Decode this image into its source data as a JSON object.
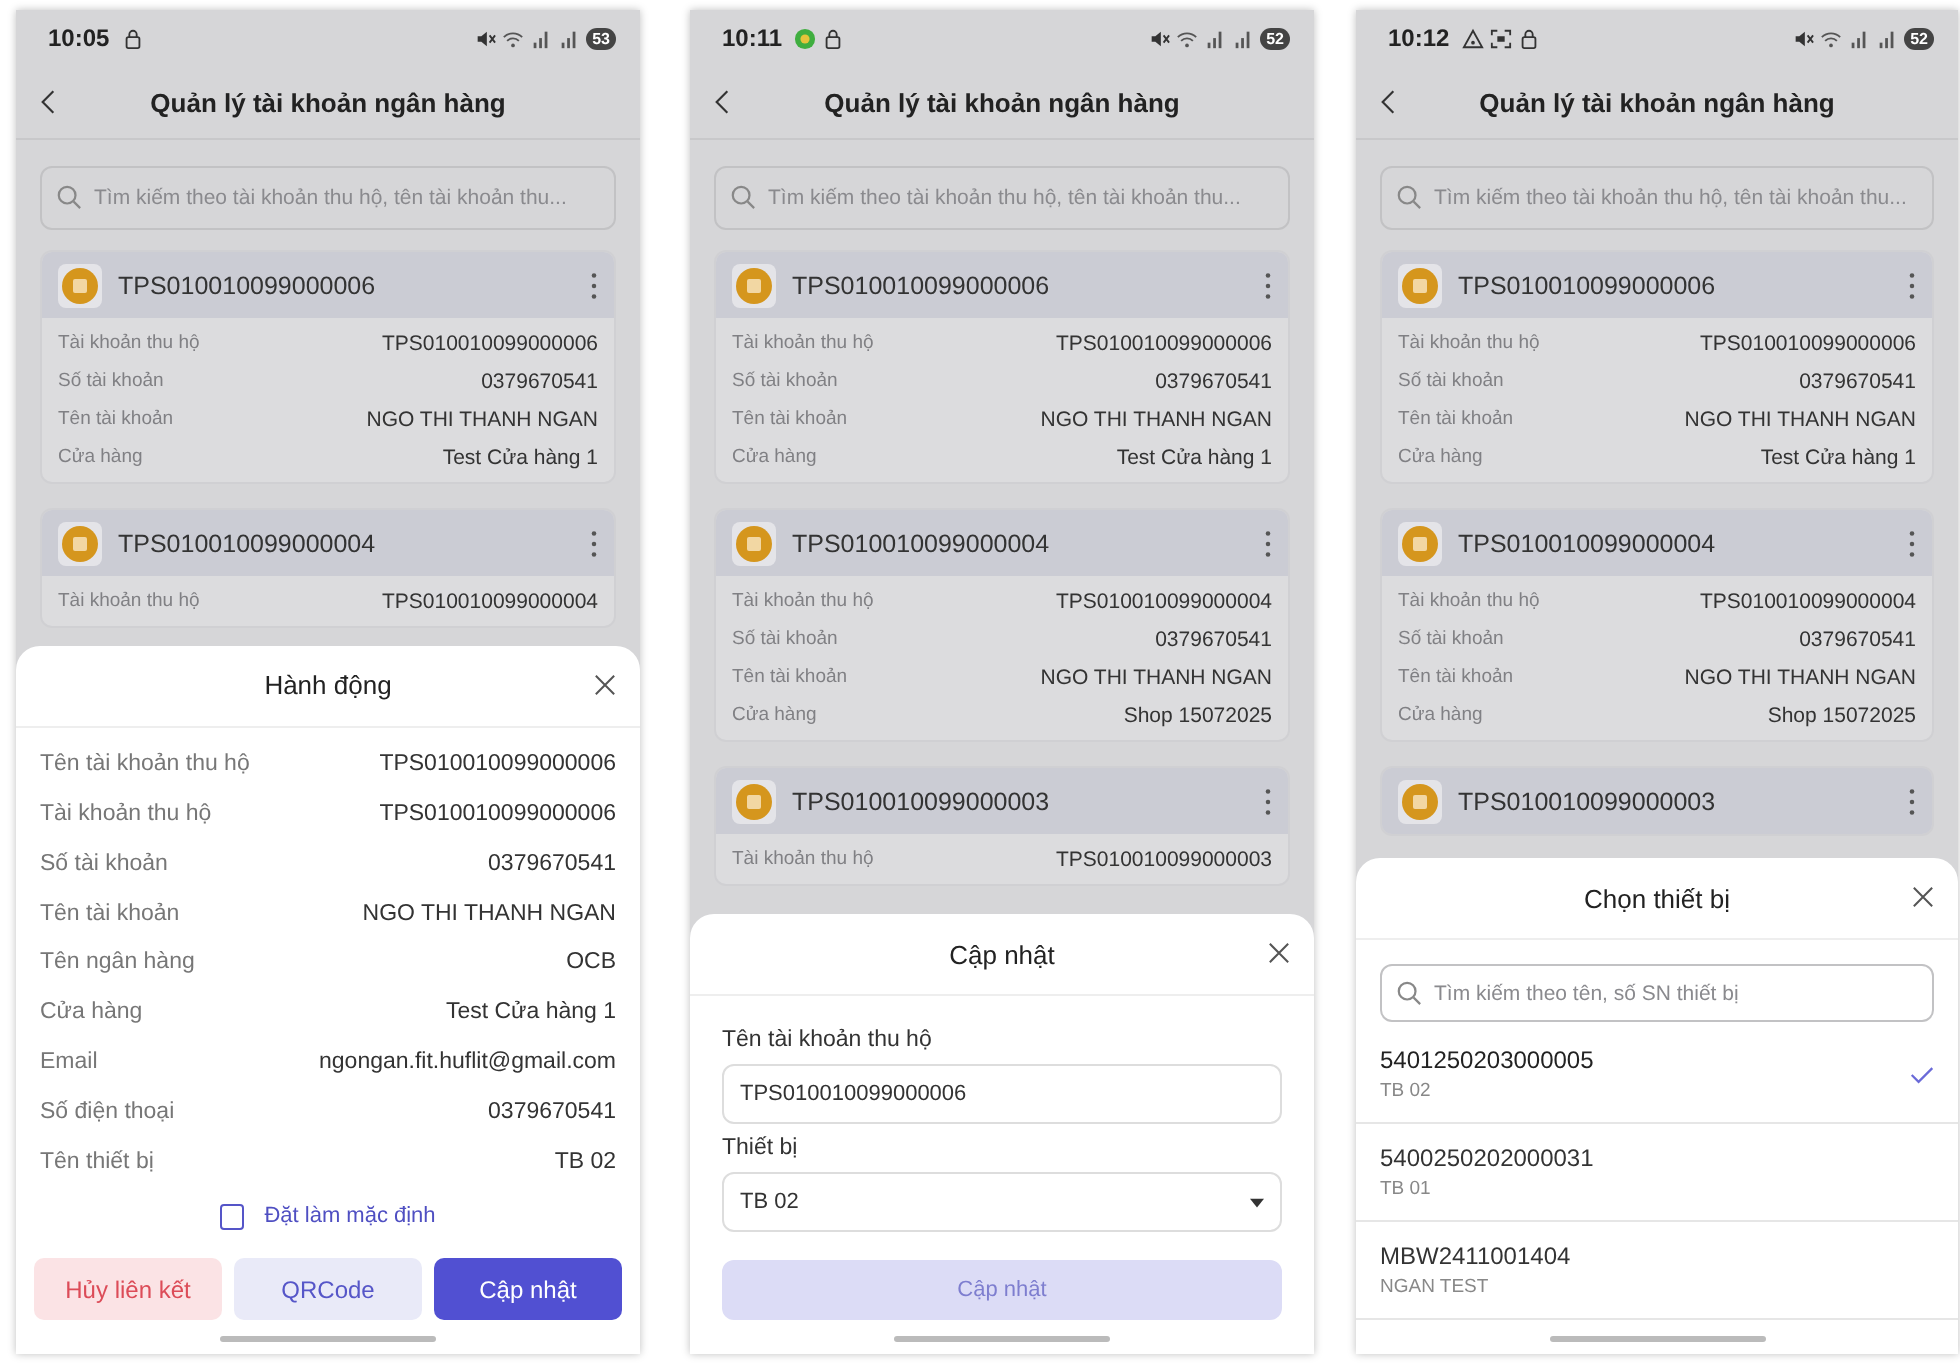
{
  "screens": [
    {
      "status_time": "10:05",
      "battery": "53",
      "title": "Quản lý tài khoản ngân hàng",
      "search_placeholder": "Tìm kiếm theo tài khoản thu hộ, tên tài khoản thu...",
      "accounts": [
        {
          "name": "TPS010010099000006",
          "fields": [
            {
              "label": "Tài khoản thu hộ",
              "value": "TPS010010099000006"
            },
            {
              "label": "Số tài khoản",
              "value": "0379670541"
            },
            {
              "label": "Tên tài khoản",
              "value": "NGO THI THANH NGAN"
            },
            {
              "label": "Cửa hàng",
              "value": "Test Cửa hàng 1"
            }
          ]
        },
        {
          "name": "TPS010010099000004",
          "fields": [
            {
              "label": "Tài khoản thu hộ",
              "value": "TPS010010099000004"
            }
          ]
        }
      ],
      "sheet": {
        "kind": "details",
        "title": "Hành động",
        "rows": [
          {
            "label": "Tên tài khoản thu hộ",
            "value": "TPS010010099000006"
          },
          {
            "label": "Tài khoản thu hộ",
            "value": "TPS010010099000006"
          },
          {
            "label": "Số tài khoản",
            "value": "0379670541"
          },
          {
            "label": "Tên tài khoản",
            "value": "NGO THI THANH NGAN"
          },
          {
            "label": "Tên ngân hàng",
            "value": "OCB"
          },
          {
            "label": "Cửa hàng",
            "value": "Test Cửa hàng 1"
          },
          {
            "label": "Email",
            "value": "ngongan.fit.huflit@gmail.com"
          },
          {
            "label": "Số điện thoại",
            "value": "0379670541"
          },
          {
            "label": "Tên thiết bị",
            "value": "TB 02"
          }
        ],
        "default_option": {
          "label": "Đặt làm mặc định",
          "checked": false
        },
        "buttons": [
          {
            "label": "Hủy liên kết",
            "kind": "danger"
          },
          {
            "label": "QRCode",
            "kind": "secondary"
          },
          {
            "label": "Cập nhật",
            "kind": "primary"
          }
        ]
      }
    },
    {
      "status_time": "10:11",
      "battery": "52",
      "title": "Quản lý tài khoản ngân hàng",
      "search_placeholder": "Tìm kiếm theo tài khoản thu hộ, tên tài khoản thu...",
      "accounts": [
        {
          "name": "TPS010010099000006",
          "fields": [
            {
              "label": "Tài khoản thu hộ",
              "value": "TPS010010099000006"
            },
            {
              "label": "Số tài khoản",
              "value": "0379670541"
            },
            {
              "label": "Tên tài khoản",
              "value": "NGO THI THANH NGAN"
            },
            {
              "label": "Cửa hàng",
              "value": "Test Cửa hàng 1"
            }
          ]
        },
        {
          "name": "TPS010010099000004",
          "fields": [
            {
              "label": "Tài khoản thu hộ",
              "value": "TPS010010099000004"
            },
            {
              "label": "Số tài khoản",
              "value": "0379670541"
            },
            {
              "label": "Tên tài khoản",
              "value": "NGO THI THANH NGAN"
            },
            {
              "label": "Cửa hàng",
              "value": "Shop 15072025"
            }
          ]
        },
        {
          "name": "TPS010010099000003",
          "fields": [
            {
              "label": "Tài khoản thu hộ",
              "value": "TPS010010099000003"
            }
          ]
        }
      ],
      "sheet": {
        "kind": "form",
        "title": "Cập nhật",
        "fields": [
          {
            "label": "Tên tài khoản thu hộ",
            "kind": "text",
            "value": "TPS010010099000006"
          },
          {
            "label": "Thiết bị",
            "kind": "select",
            "value": "TB 02"
          }
        ],
        "submit": {
          "label": "Cập nhật",
          "disabled": true
        }
      }
    },
    {
      "status_time": "10:12",
      "battery": "52",
      "title": "Quản lý tài khoản ngân hàng",
      "search_placeholder": "Tìm kiếm theo tài khoản thu hộ, tên tài khoản thu...",
      "accounts": [
        {
          "name": "TPS010010099000006",
          "fields": [
            {
              "label": "Tài khoản thu hộ",
              "value": "TPS010010099000006"
            },
            {
              "label": "Số tài khoản",
              "value": "0379670541"
            },
            {
              "label": "Tên tài khoản",
              "value": "NGO THI THANH NGAN"
            },
            {
              "label": "Cửa hàng",
              "value": "Test Cửa hàng 1"
            }
          ]
        },
        {
          "name": "TPS010010099000004",
          "fields": [
            {
              "label": "Tài khoản thu hộ",
              "value": "TPS010010099000004"
            },
            {
              "label": "Số tài khoản",
              "value": "0379670541"
            },
            {
              "label": "Tên tài khoản",
              "value": "NGO THI THANH NGAN"
            },
            {
              "label": "Cửa hàng",
              "value": "Shop 15072025"
            }
          ]
        },
        {
          "name": "TPS010010099000003"
        }
      ],
      "sheet": {
        "kind": "picker",
        "title": "Chọn thiết bị",
        "search_placeholder": "Tìm kiếm theo tên, số SN thiết bị",
        "options": [
          {
            "serial": "5401250203000005",
            "name": "TB 02",
            "selected": true
          },
          {
            "serial": "5400250202000031",
            "name": "TB 01",
            "selected": false
          },
          {
            "serial": "MBW2411001404",
            "name": "NGAN TEST",
            "selected": false
          }
        ]
      }
    }
  ]
}
